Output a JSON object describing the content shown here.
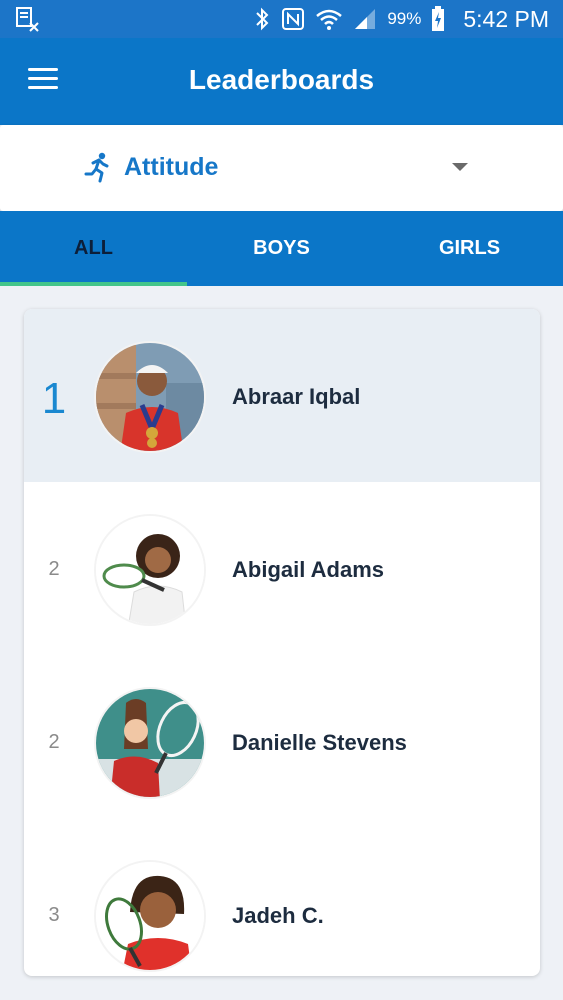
{
  "status_bar": {
    "battery": "99%",
    "time": "5:42 PM"
  },
  "app_bar": {
    "title": "Leaderboards"
  },
  "selector": {
    "label": "Attitude",
    "icon": "runner-icon"
  },
  "tabs": [
    {
      "label": "ALL",
      "active": true
    },
    {
      "label": "BOYS",
      "active": false
    },
    {
      "label": "GIRLS",
      "active": false
    }
  ],
  "leaderboard": [
    {
      "rank": "1",
      "name": "Abraar Iqbal"
    },
    {
      "rank": "2",
      "name": "Abigail Adams"
    },
    {
      "rank": "2",
      "name": "Danielle Stevens"
    },
    {
      "rank": "3",
      "name": "Jadeh C."
    }
  ],
  "colors": {
    "primary": "#0b76c8",
    "accent_indicator": "#43c58a",
    "selected_row": "#e8eef4",
    "rank_highlight": "#1a88d0"
  }
}
